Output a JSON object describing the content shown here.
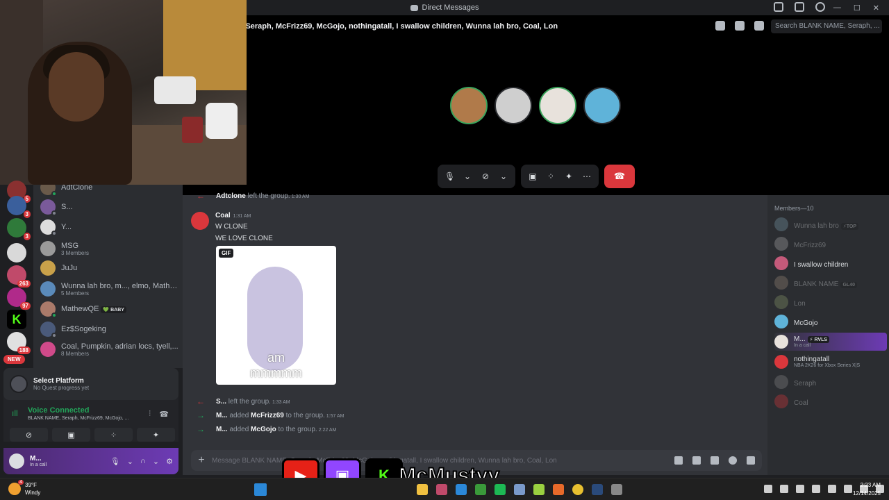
{
  "window": {
    "title": "Direct Messages"
  },
  "call": {
    "participants_header": "E, Seraph, McFrizz69, McGojo, nothingatall, I swallow children, Wunna lah bro, Coal, Lon",
    "search_placeholder": "Search BLANK NAME, Seraph, ..."
  },
  "servers": {
    "badges": [
      "5",
      "3",
      "3",
      "263",
      "97",
      "188"
    ],
    "new_label": "NEW"
  },
  "dms": [
    {
      "name": "AdtClone",
      "sub": ""
    },
    {
      "name": "S...",
      "sub": ""
    },
    {
      "name": "Y...",
      "sub": ""
    },
    {
      "name": "MSG",
      "sub": "3 Members"
    },
    {
      "name": "JuJu",
      "sub": ""
    },
    {
      "name": "Wunna lah bro, m..., elmo, Mathe...",
      "sub": "5 Members"
    },
    {
      "name": "MathewQE",
      "sub": "",
      "tag": "💚 BABY"
    },
    {
      "name": "Ez$Sogeking",
      "sub": ""
    },
    {
      "name": "Coal, Pumpkin, adrian locs, tyell,...",
      "sub": "8 Members"
    }
  ],
  "quest": {
    "title": "Select Platform",
    "subtitle": "No Quest progress yet"
  },
  "voice": {
    "status": "Voice Connected",
    "channel": "BLANK NAME, Seraph, McFrizz69, McGojo, ..."
  },
  "user": {
    "name": "M...",
    "status": "In a call"
  },
  "chat": {
    "top_system": {
      "actor": "Adtclone",
      "text": "left the group.",
      "time": "1:30 AM"
    },
    "message": {
      "author": "Coal",
      "time": "1:31 AM",
      "line1": "W CLONE",
      "line2": "WE LOVE CLONE",
      "gif_label": "GIF",
      "gif_caption_1": "am",
      "gif_caption_2": "mmmmm"
    },
    "system": [
      {
        "actor": "S...",
        "text": "left the group.",
        "target": "",
        "time": "1:33 AM",
        "kind": "leave"
      },
      {
        "actor": "M...",
        "text": "added",
        "target": "McFrizz69",
        "suffix": "to the group.",
        "time": "1:57 AM",
        "kind": "add"
      },
      {
        "actor": "M...",
        "text": "added",
        "target": "McGojo",
        "suffix": "to the group.",
        "time": "2:22 AM",
        "kind": "add"
      }
    ],
    "composer_placeholder": "Message BLANK NAME, Seraph, McFrizz69, McGojo, nothingatall, I swallow children, Wunna lah bro, Coal, Lon"
  },
  "members": {
    "header": "Members—10",
    "list": [
      {
        "name": "Wunna lah bro",
        "sub": "",
        "tag": "⚡TOP",
        "online": false
      },
      {
        "name": "McFrizz69",
        "sub": "",
        "tag": "",
        "online": false
      },
      {
        "name": "I swallow children",
        "sub": "",
        "tag": "",
        "online": true
      },
      {
        "name": "BLANK NAME",
        "sub": "",
        "tag": "GL40",
        "online": false
      },
      {
        "name": "Lon",
        "sub": "",
        "tag": "",
        "online": false
      },
      {
        "name": "McGojo",
        "sub": "",
        "tag": "",
        "online": true
      },
      {
        "name": "M...",
        "sub": "In a call",
        "tag": "⚡ RVLS",
        "online": true
      },
      {
        "name": "nothingatall",
        "sub": "NBA 2K26 for Xbox Series X|S",
        "tag": "",
        "online": true
      },
      {
        "name": "Seraph",
        "sub": "",
        "tag": "",
        "online": false
      },
      {
        "name": "Coal",
        "sub": "",
        "tag": "",
        "online": false
      }
    ]
  },
  "stream": {
    "handle": "McMustyy"
  },
  "taskbar": {
    "weather_temp": "39°F",
    "weather_desc": "Windy",
    "weather_badge": "4",
    "time": "2:23 AM",
    "date": "12/14/2025"
  }
}
